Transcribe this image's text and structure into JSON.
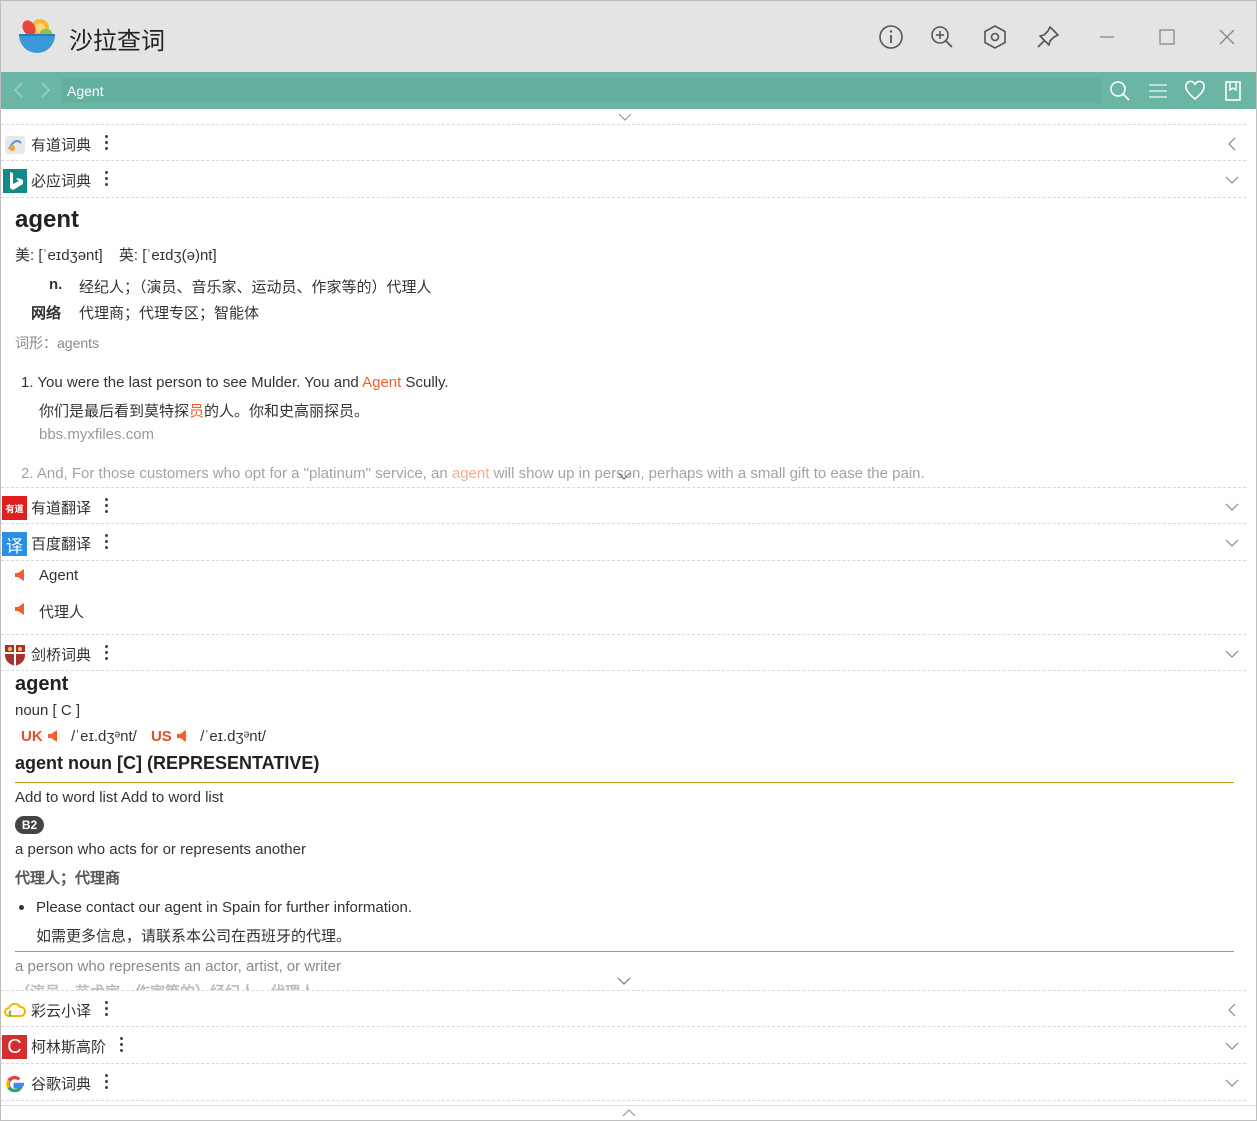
{
  "window": {
    "title": "沙拉查词"
  },
  "search": {
    "value": "Agent"
  },
  "sections": {
    "youdao": {
      "title": "有道词典"
    },
    "bing": {
      "title": "必应词典",
      "word": "agent",
      "phonetic_us_label": "美:",
      "phonetic_us": "[ˈeɪdʒənt]",
      "phonetic_uk_label": "英:",
      "phonetic_uk": "[ˈeɪdʒ(ə)nt]",
      "pos_n": "n.",
      "def_n": "经纪人；（演员、音乐家、运动员、作家等的）代理人",
      "pos_web": "网络",
      "def_web": "代理商；代理专区；智能体",
      "forms": "词形：agents",
      "ex1_num": "1.",
      "ex1_en_a": "You were the last person to see Mulder. You and",
      "ex1_en_hl": "Agent",
      "ex1_en_b": "Scully.",
      "ex1_zh_a": "你们是最后看到莫特探",
      "ex1_zh_hl": "员",
      "ex1_zh_b": "的人。你和史高丽探员。",
      "ex1_src": "bbs.myxfiles.com",
      "ex2_num": "2.",
      "ex2_en_a": "And, For those customers who opt for a \"platinum\" service, an",
      "ex2_en_hl": "agent",
      "ex2_en_b": "will show up in person, perhaps with a small gift to ease the pain."
    },
    "youdao_trans": {
      "title": "有道翻译",
      "icon_text": "有道"
    },
    "baidu": {
      "title": "百度翻译",
      "icon_text": "译",
      "line1": "Agent",
      "line2": "代理人"
    },
    "cambridge": {
      "title": "剑桥词典",
      "word": "agent",
      "pos": "noun [ C ]",
      "uk_label": "UK",
      "uk_ipa": "/ˈeɪ.dʒᵊnt/",
      "us_label": "US",
      "us_ipa": "/ˈeɪ.dʒᵊnt/",
      "heading": "agent noun [C] (REPRESENTATIVE)",
      "add_list": "Add to word list Add to word list",
      "level": "B2",
      "def": "a person who acts for or represents another",
      "def_zh": "代理人；代理商",
      "ex_en": "Please contact our agent in Spain for further information.",
      "ex_zh": "如需更多信息，请联系本公司在西班牙的代理。",
      "def2": "a person who represents an actor, artist, or writer",
      "def2_zh": "（演员、艺术家、作家等的）经纪人，代理人"
    },
    "caiyun": {
      "title": "彩云小译"
    },
    "collins": {
      "title": "柯林斯高阶",
      "icon_text": "C"
    },
    "google": {
      "title": "谷歌词典"
    }
  },
  "colors": {
    "accent": "#6ab5a4",
    "highlight": "#f25e2d",
    "rule": "#c49a27"
  }
}
